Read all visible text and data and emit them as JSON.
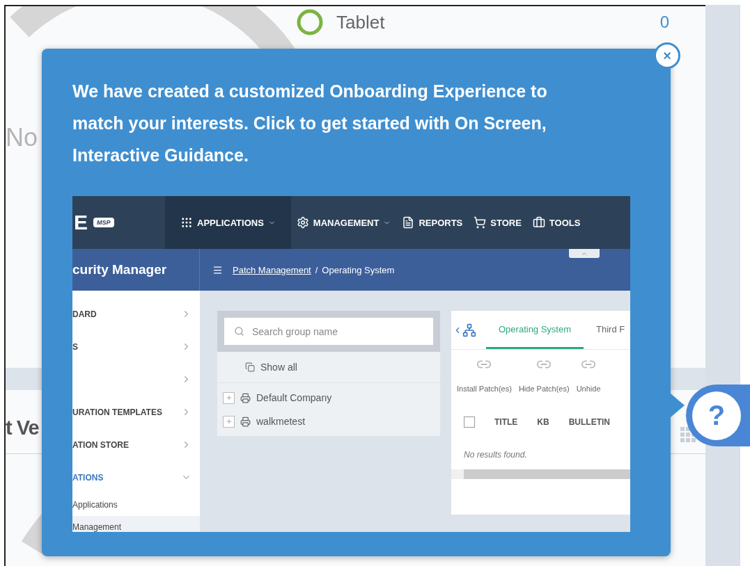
{
  "background": {
    "device_row": {
      "label": "Tablet",
      "count": "0"
    },
    "empty_text": "No",
    "section_title": "t Ve"
  },
  "popup": {
    "message": "We have created a customized Onboarding Experience to match your interests. Click to get started with On Screen, Interactive Guidance.",
    "close_label": "×",
    "help_label": "?",
    "preview": {
      "logo_text": "E",
      "logo_badge": "MSP",
      "nav": [
        {
          "label": "APPLICATIONS",
          "dropdown": true,
          "selected": true
        },
        {
          "label": "MANAGEMENT",
          "dropdown": true,
          "selected": false
        },
        {
          "label": "REPORTS",
          "dropdown": false,
          "selected": false
        },
        {
          "label": "STORE",
          "dropdown": false,
          "selected": false
        },
        {
          "label": "TOOLS",
          "dropdown": false,
          "selected": false
        }
      ],
      "product_title": "curity Manager",
      "breadcrumb": {
        "link": "Patch Management",
        "separator": "/",
        "current": "Operating System"
      },
      "sidebar": [
        {
          "kind": "section",
          "label": "DARD",
          "expanded": false
        },
        {
          "kind": "section",
          "label": "S",
          "expanded": false
        },
        {
          "kind": "section",
          "expanded": false
        },
        {
          "kind": "section",
          "label": "URATION TEMPLATES",
          "expanded": false
        },
        {
          "kind": "section",
          "label": "ATION STORE",
          "expanded": false
        },
        {
          "kind": "section",
          "label": "ATIONS",
          "expanded": true
        },
        {
          "kind": "subitem",
          "label": "Applications",
          "selected": false
        },
        {
          "kind": "subitem",
          "label": "Management",
          "selected": true
        }
      ],
      "groups": {
        "search_placeholder": "Search group name",
        "show_all": "Show all",
        "items": [
          {
            "label": "Default Company"
          },
          {
            "label": "walkmetest"
          }
        ]
      },
      "tabs": [
        {
          "label": "Operating System",
          "selected": true
        },
        {
          "label": "Third F",
          "selected": false
        }
      ],
      "actions": [
        "Install Patch(es)",
        "Hide Patch(es)",
        "Unhide"
      ],
      "header_checkbox": {
        "checked": false
      },
      "columns": [
        "TITLE",
        "KB",
        "BULLETIN"
      ],
      "empty_message": "No results found."
    }
  }
}
